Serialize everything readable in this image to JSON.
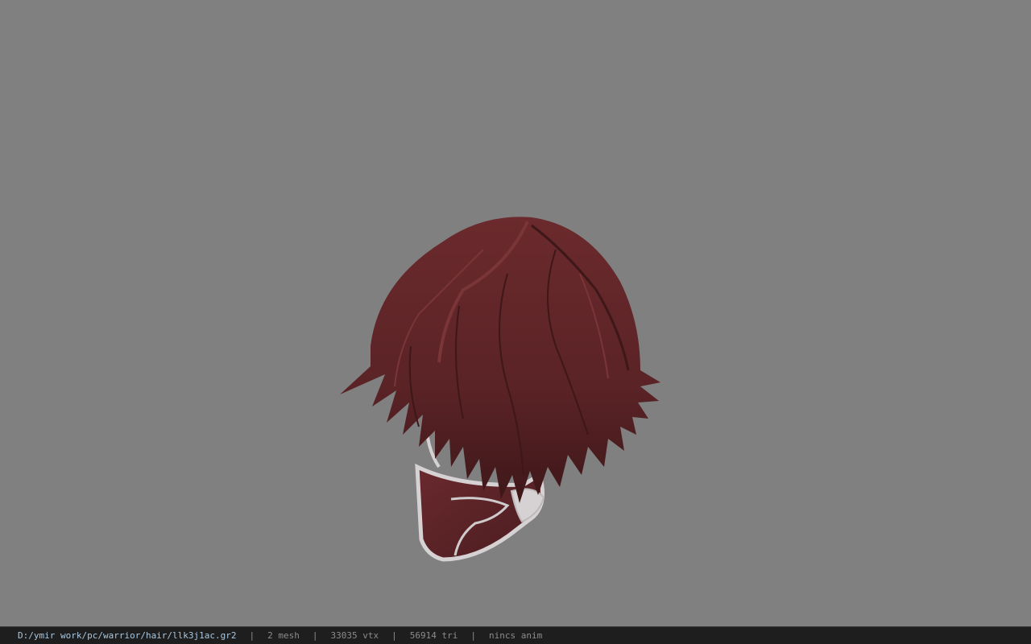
{
  "viewer": {
    "background_color": "#808080",
    "model_icon": "hair-mesh-icon",
    "hair_color": "#5a2326",
    "mask_color": "#d6d2d4"
  },
  "statusbar": {
    "file_path": "D:/ymir work/pc/warrior/hair/llk3j1ac.gr2",
    "separator": "|",
    "mesh_count": "2 mesh",
    "vertex_count": "33035 vtx",
    "triangle_count": "56914 tri",
    "anim_status": "nincs anim"
  }
}
